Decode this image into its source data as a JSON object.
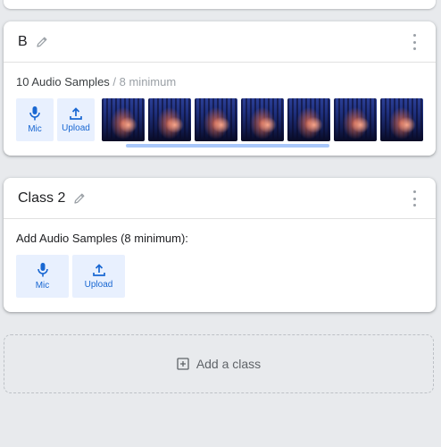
{
  "classes": [
    {
      "name": "B",
      "samples_count": "10 Audio Samples",
      "samples_min": " / 8 minimum",
      "tools": [
        {
          "icon": "mic-icon",
          "label": "Mic"
        },
        {
          "icon": "upload-icon",
          "label": "Upload"
        }
      ],
      "thumbnail_count": 7
    },
    {
      "name": "Class 2",
      "prompt": "Add Audio Samples (8 minimum):",
      "tools": [
        {
          "icon": "mic-icon",
          "label": "Mic"
        },
        {
          "icon": "upload-icon",
          "label": "Upload"
        }
      ]
    }
  ],
  "add_class": {
    "icon": "add-box-icon",
    "label": "Add a class"
  },
  "colors": {
    "accent": "#1967d2",
    "tool_bg": "#e8f0fe",
    "page_bg": "#e8eaed",
    "muted_text": "#9aa0a6",
    "scrollbar": "#a8c7fa"
  }
}
